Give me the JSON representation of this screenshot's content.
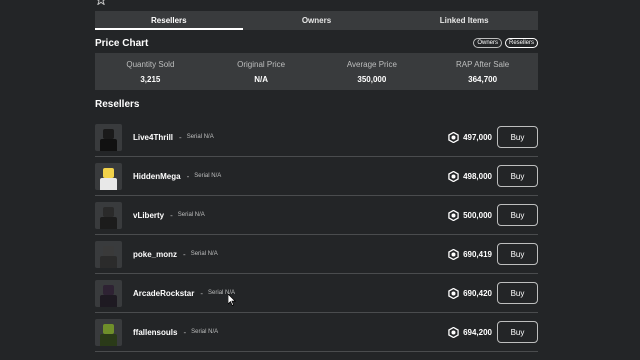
{
  "tabs": [
    {
      "label": "Resellers",
      "active": true
    },
    {
      "label": "Owners",
      "active": false
    },
    {
      "label": "Linked Items",
      "active": false
    }
  ],
  "price_chart": {
    "title": "Price Chart",
    "toggles": [
      "Owners",
      "Resellers"
    ]
  },
  "stats": [
    {
      "label": "Quantity Sold",
      "value": "3,215"
    },
    {
      "label": "Original Price",
      "value": "N/A"
    },
    {
      "label": "Average Price",
      "value": "350,000"
    },
    {
      "label": "RAP After Sale",
      "value": "364,700"
    }
  ],
  "resellers": {
    "title": "Resellers",
    "buy_label": "Buy",
    "rows": [
      {
        "username": "Live4Thrill",
        "dash": "-",
        "serial": "Serial N/A",
        "price": "497,000",
        "head": "#1a1a1a",
        "body": "#111111"
      },
      {
        "username": "HiddenMega",
        "dash": "-",
        "serial": "Serial N/A",
        "price": "498,000",
        "head": "#f2d24a",
        "body": "#e8e8e8"
      },
      {
        "username": "vLiberty",
        "dash": "-",
        "serial": "Serial N/A",
        "price": "500,000",
        "head": "#2a2a2a",
        "body": "#1c1c1c"
      },
      {
        "username": "poke_monz",
        "dash": "-",
        "serial": "Serial N/A",
        "price": "690,419",
        "head": "#3a3a3a",
        "body": "#2b2b2b"
      },
      {
        "username": "ArcadeRockstar",
        "dash": "-",
        "serial": "Serial N/A",
        "price": "690,420",
        "head": "#2e2233",
        "body": "#1e1a22"
      },
      {
        "username": "ffallensouls",
        "dash": "-",
        "serial": "Serial N/A",
        "price": "694,200",
        "head": "#6f8f2a",
        "body": "#2a3a18"
      }
    ]
  },
  "colors": {
    "background": "#232527",
    "panel": "#393b3d",
    "text": "#ffffff",
    "muted": "#bdbebe"
  }
}
